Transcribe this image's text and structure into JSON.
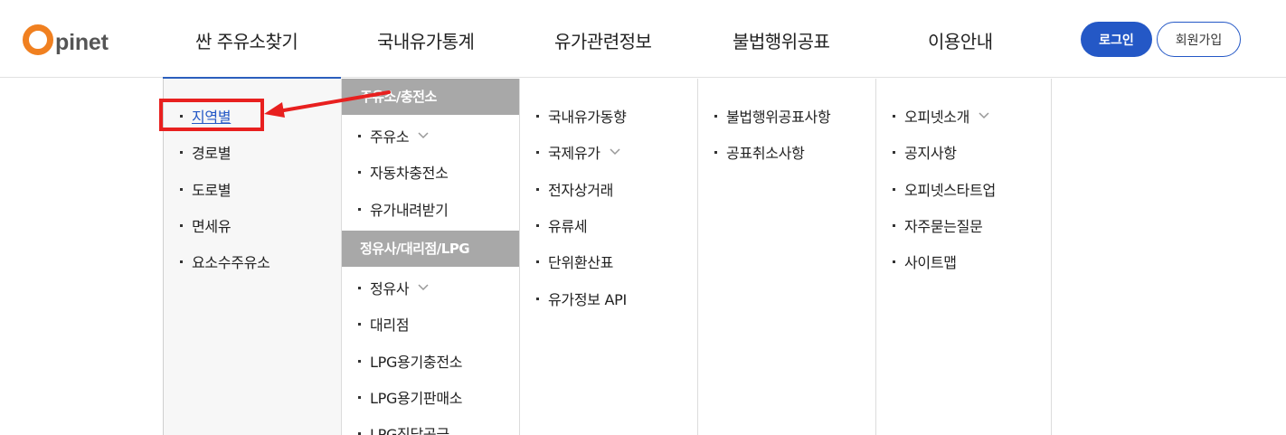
{
  "logo": {
    "letter": "O",
    "text": "pinet"
  },
  "nav": [
    "싼 주유소찾기",
    "국내유가통계",
    "유가관련정보",
    "불법행위공표",
    "이용안내"
  ],
  "auth": {
    "login": "로그인",
    "join": "회원가입"
  },
  "menu": {
    "col1": [
      "지역별",
      "경로별",
      "도로별",
      "면세유",
      "요소수주유소"
    ],
    "col2": {
      "group1_title": "주유소/충전소",
      "group1_items": [
        "주유소",
        "자동차충전소",
        "유가내려받기"
      ],
      "group2_title": "정유사/대리점/LPG",
      "group2_items": [
        "정유사",
        "대리점",
        "LPG용기충전소",
        "LPG용기판매소",
        "LPG직답공급"
      ]
    },
    "col3": [
      "국내유가동향",
      "국제유가",
      "전자상거래",
      "유류세",
      "단위환산표",
      "유가정보 API"
    ],
    "col4": [
      "불법행위공표사항",
      "공표취소사항"
    ],
    "col5": [
      "오피넷소개",
      "공지사항",
      "오피넷스타트업",
      "자주묻는질문",
      "사이트맵"
    ]
  },
  "colors": {
    "accent": "#2458c6",
    "logo_orange": "#f08020",
    "annotation_red": "#e8201f",
    "group_header": "#a8a8a8"
  }
}
